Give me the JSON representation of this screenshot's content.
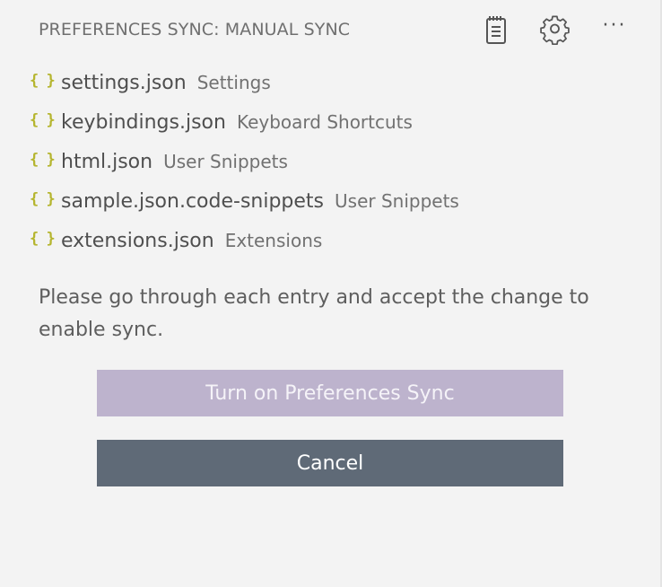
{
  "header": {
    "title": "PREFERENCES SYNC: MANUAL SYNC",
    "actions": [
      "notes-icon",
      "gear-icon",
      "more-icon"
    ],
    "more_glyph": "···"
  },
  "entries": [
    {
      "icon": "json-icon",
      "glyph": "{ }",
      "name": "settings.json",
      "description": "Settings"
    },
    {
      "icon": "json-icon",
      "glyph": "{ }",
      "name": "keybindings.json",
      "description": "Keyboard Shortcuts"
    },
    {
      "icon": "json-icon",
      "glyph": "{ }",
      "name": "html.json",
      "description": "User Snippets"
    },
    {
      "icon": "json-icon",
      "glyph": "{ }",
      "name": "sample.json.code-snippets",
      "description": "User Snippets"
    },
    {
      "icon": "json-icon",
      "glyph": "{ }",
      "name": "extensions.json",
      "description": "Extensions"
    }
  ],
  "message": "Please go through each entry and accept the change to enable sync.",
  "buttons": {
    "primary_label": "Turn on Preferences Sync",
    "secondary_label": "Cancel"
  },
  "colors": {
    "background": "#f3f3f3",
    "json_icon": "#b5b52e",
    "primary_button": "#bdb3cd",
    "secondary_button": "#5f6a77"
  }
}
